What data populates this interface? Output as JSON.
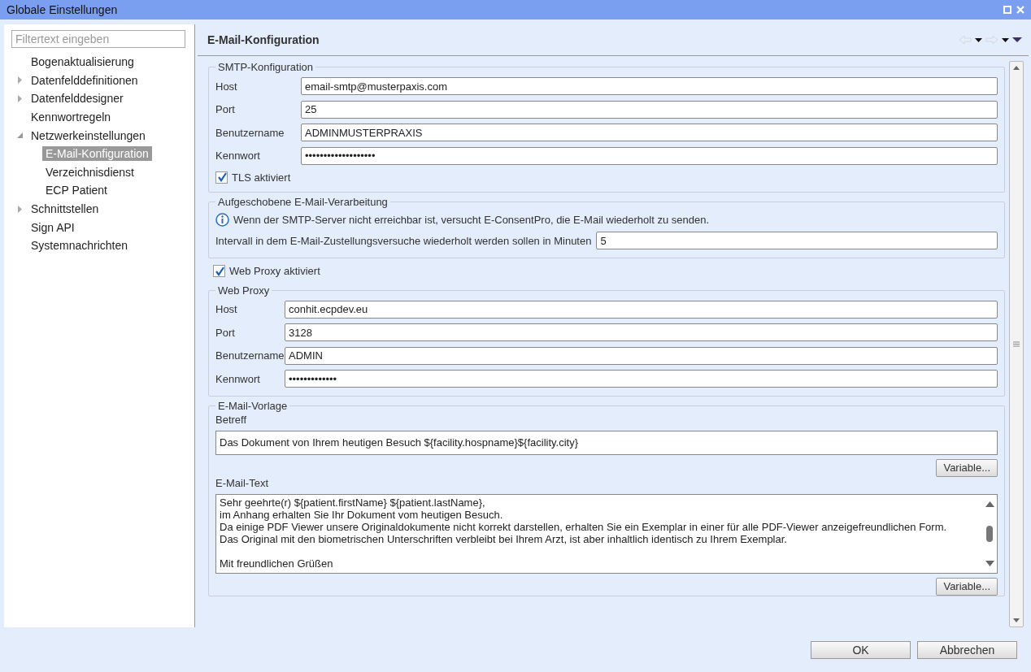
{
  "window": {
    "title": "Globale Einstellungen"
  },
  "sidebar": {
    "filter": {
      "placeholder": "Filtertext eingeben"
    },
    "items": [
      {
        "label": "Bogenaktualisierung",
        "selected": false
      },
      {
        "label": "Datenfelddefinitionen",
        "expanded": false,
        "selected": false
      },
      {
        "label": "Datenfelddesigner",
        "expanded": false,
        "selected": false
      },
      {
        "label": "Kennwortregeln",
        "selected": false
      },
      {
        "label": "Netzwerkeinstellungen",
        "expanded": true,
        "selected": false,
        "children": [
          {
            "label": "E-Mail-Konfiguration",
            "selected": true
          },
          {
            "label": "Verzeichnisdienst",
            "selected": false
          },
          {
            "label": "ECP Patient",
            "selected": false
          }
        ]
      },
      {
        "label": "Schnittstellen",
        "expanded": false,
        "selected": false
      },
      {
        "label": "Sign API",
        "selected": false
      },
      {
        "label": "Systemnachrichten",
        "selected": false
      }
    ]
  },
  "page": {
    "title": "E-Mail-Konfiguration"
  },
  "smtp": {
    "legend": "SMTP-Konfiguration",
    "fields": [
      {
        "label": "Host",
        "value": "email-smtp@musterpaxis.com"
      },
      {
        "label": "Port",
        "value": "25"
      },
      {
        "label": "Benutzername",
        "value": "ADMINMUSTERPRAXIS"
      },
      {
        "label": "Kennwort",
        "value": "•••••••••••••••••••"
      }
    ],
    "tls": {
      "label": "TLS aktiviert",
      "checked": true
    }
  },
  "deferred": {
    "legend": "Aufgeschobene E-Mail-Verarbeitung",
    "info": "Wenn der SMTP-Server nicht erreichbar ist, versucht E-ConsentPro, die E-Mail wiederholt zu senden.",
    "interval": {
      "label": "Intervall in dem E-Mail-Zustellungsversuche wiederholt werden sollen in Minuten",
      "value": "5"
    }
  },
  "proxy_toggle": {
    "label": "Web Proxy aktiviert",
    "checked": true
  },
  "proxy": {
    "legend": "Web Proxy",
    "fields": [
      {
        "label": "Host",
        "value": "conhit.ecpdev.eu"
      },
      {
        "label": "Port",
        "value": "3128"
      },
      {
        "label": "Benutzername",
        "value": "ADMIN"
      },
      {
        "label": "Kennwort",
        "value": "•••••••••••••"
      }
    ]
  },
  "template": {
    "legend": "E-Mail-Vorlage",
    "subject_label": "Betreff",
    "subject": "Das Dokument von Ihrem heutigen Besuch ${facility.hospname}${facility.city}",
    "subject_button": "Variable...",
    "body_label": "E-Mail-Text",
    "body_paragraphs": [
      [
        "Sehr geehrte(r) ${patient.firstName} ${patient.lastName},",
        "im Anhang erhalten Sie Ihr Dokument vom heutigen Besuch.",
        "Da einige PDF Viewer unsere Originaldokumente nicht korrekt darstellen, erhalten Sie ein Exemplar in einer für alle PDF-Viewer anzeigefreundlichen Form.",
        "Das Original mit den biometrischen Unterschriften verbleibt bei Ihrem Arzt, ist aber inhaltlich identisch zu Ihrem Exemplar."
      ],
      [
        "Mit freundlichen Grüßen"
      ]
    ],
    "body_button": "Variable..."
  },
  "buttons": [
    "OK",
    "Abbrechen"
  ]
}
